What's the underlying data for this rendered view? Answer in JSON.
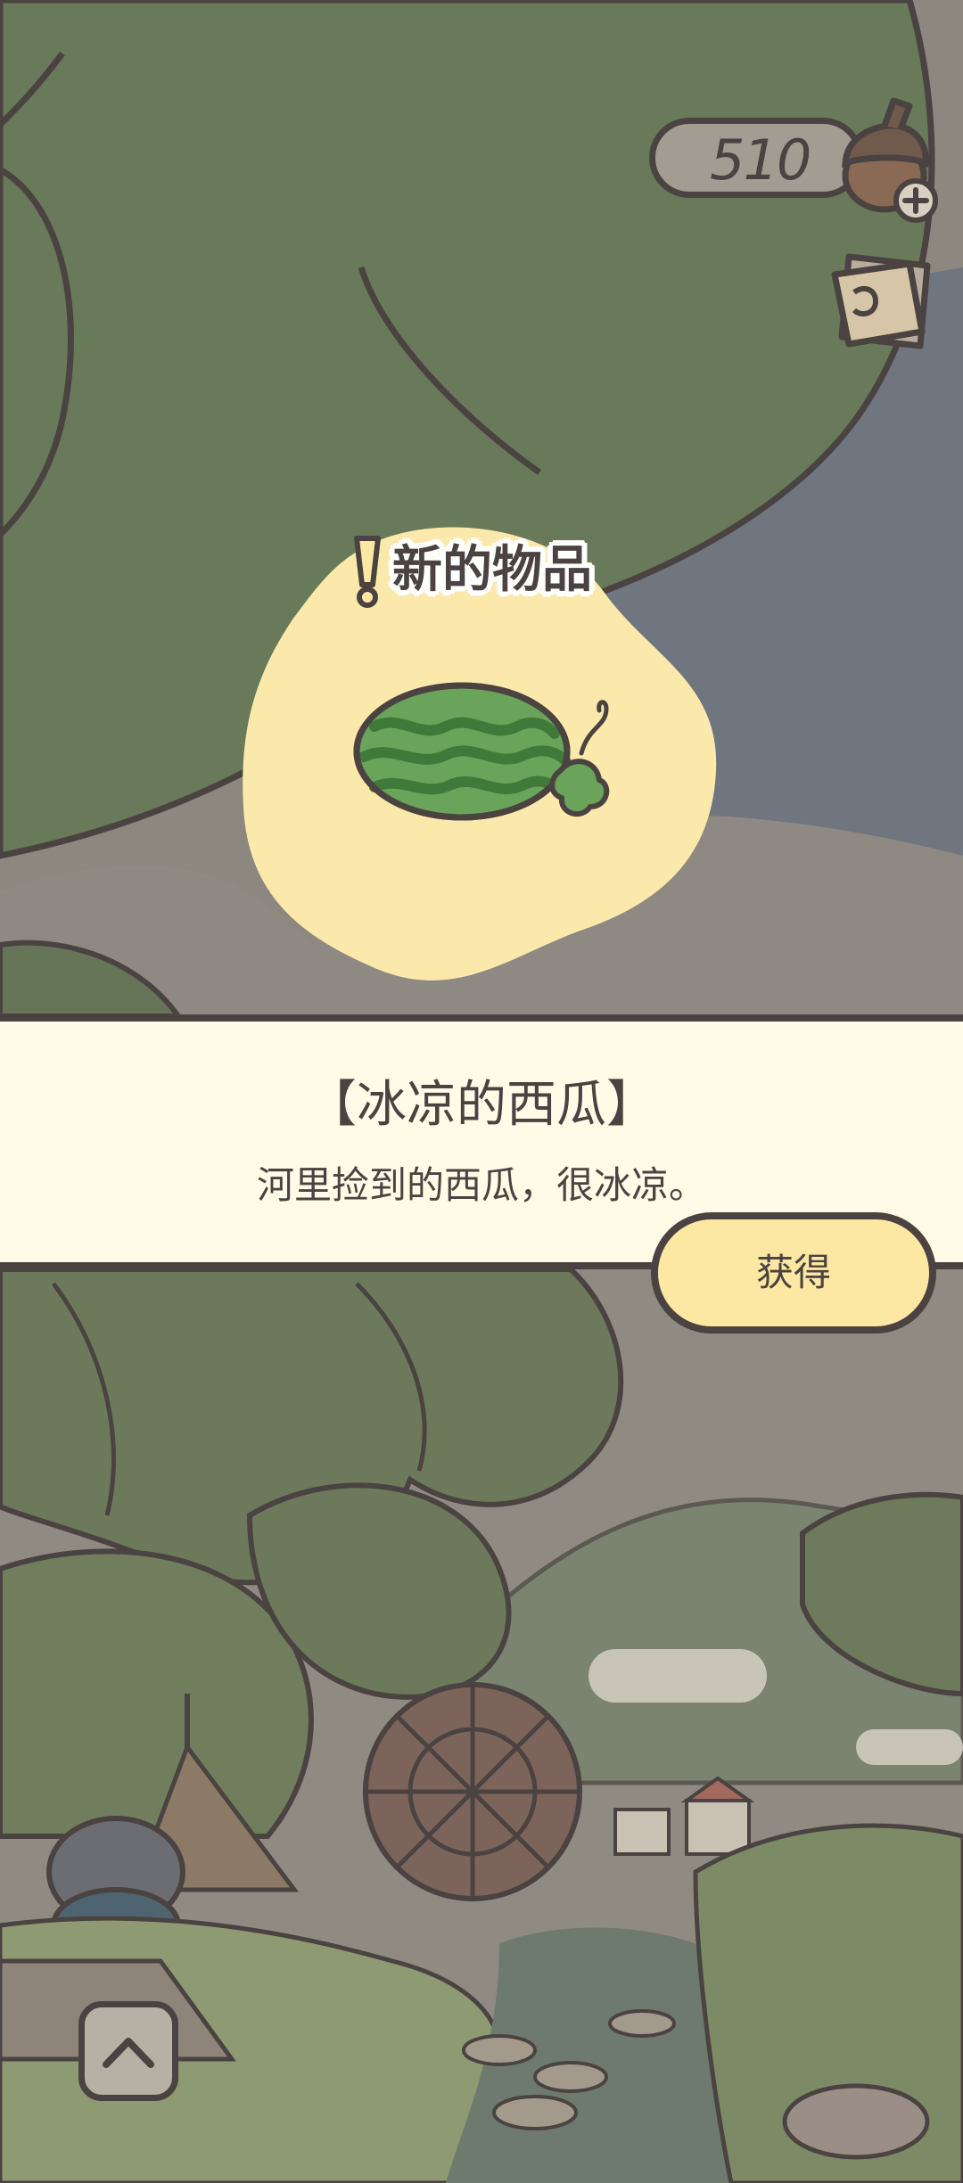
{
  "header": {
    "clover_count": "510"
  },
  "popup": {
    "heading": "新的物品",
    "item_name": "【冰凉的西瓜】",
    "item_description": "河里捡到的西瓜，很冰凉。",
    "obtain_label": "获得"
  },
  "icons": {
    "currency": "acorn-icon",
    "add": "plus-icon",
    "tickets": "tickets-icon",
    "alert": "exclaim-icon",
    "item": "watermelon-icon",
    "nav": "chevron-up-icon"
  },
  "colors": {
    "outline": "#4a4341",
    "banner_bg": "#fffbe6",
    "button_bg": "#fde8a3",
    "blob_bg": "#fbe9ab",
    "watermelon_green": "#6aa35a"
  }
}
